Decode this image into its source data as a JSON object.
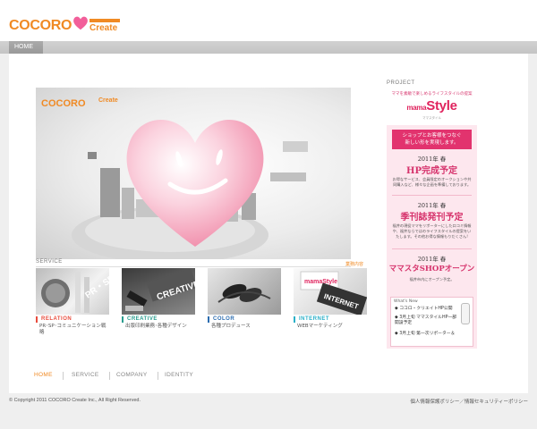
{
  "header": {
    "logo_text": "COCORO",
    "logo_sub": "Create"
  },
  "nav": {
    "home": "HOME"
  },
  "hero": {
    "logo_text": "COCORO",
    "logo_sub": "Create"
  },
  "service": {
    "label": "SERVICE",
    "more": "業務内容",
    "items": [
      {
        "title": "RELATION",
        "desc": "PR･SP･コミュニケーション戦略",
        "color": "#e84c3d"
      },
      {
        "title": "CREATIVE",
        "desc": "出版印刷業務･各種デザイン",
        "color": "#2a9d8f"
      },
      {
        "title": "COLOR",
        "desc": "各種プロデュース",
        "color": "#2b6cb0"
      },
      {
        "title": "INTERNET",
        "desc": "WEBマーケティング",
        "color": "#2bb0c8"
      }
    ],
    "image_texts": {
      "relation": "PR・SP",
      "creative": "CREATIVE",
      "internet": "INTERNET",
      "internet_brand": "mamaStyle"
    }
  },
  "project": {
    "label": "PROJECT",
    "tagline": "ママを素敵で楽しめるライフスタイルの提案",
    "brand_small": "mama",
    "brand": "Style",
    "brand_sub": "ママスタイル",
    "banner_line1": "ショップとお客様をつなぐ",
    "banner_line2": "新しい形を実現します。",
    "blocks": [
      {
        "year": "2011年 春",
        "headline": "HP完成予定",
        "body": "お得なサービス、会員限定のオークションや共同購入など、様々な企画を準備しております。"
      },
      {
        "year": "2011年 春",
        "headline": "季刊誌発刊予定",
        "body": "福井の現役ママをリポーターにした口コミ情報や、福井ならではのライフスタイルの提案をいたします。その他お得な情報もりだくさん!"
      },
      {
        "year": "2011年 春",
        "headline": "ママスタSHOPオープン",
        "body": "福井市内にオープン予定。"
      }
    ],
    "whats_new": {
      "title": "What's New",
      "items": [
        {
          "text": "ココロ・クリエイトHP公開"
        },
        {
          "text": "3月上旬 ママスタイルHP一部開設予定"
        },
        {
          "text": "3月上旬 第一次リポーター＆"
        }
      ]
    }
  },
  "footer_nav": [
    "HOME",
    "SERVICE",
    "COMPANY",
    "IDENTITY"
  ],
  "copyright": "© Copyright 2011 COCORO Create Inc., All Right Reserved.",
  "policy": "個人情報保護ポリシー／情報セキュリティーポリシー",
  "colors": {
    "accent": "#f08a24",
    "pink": "#e0245e",
    "panel_bg": "#fde7ee"
  }
}
